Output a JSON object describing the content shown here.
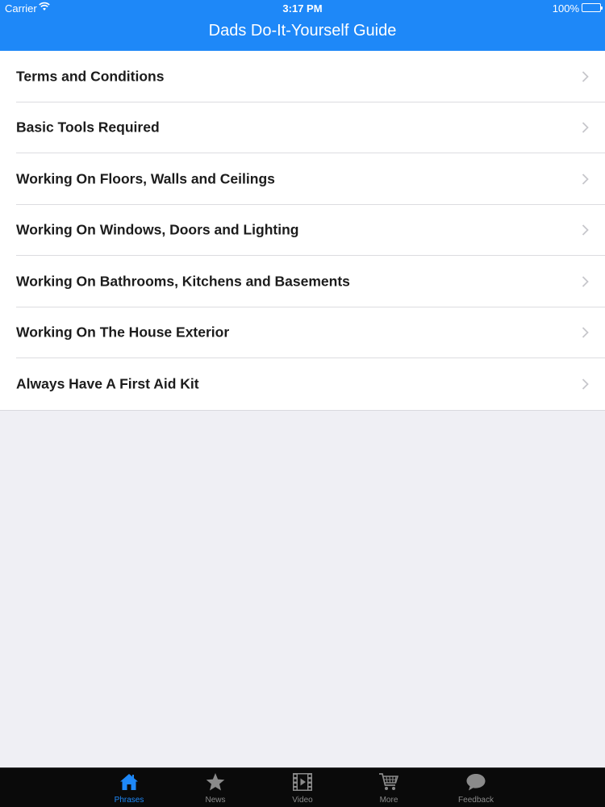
{
  "status_bar": {
    "carrier": "Carrier",
    "time": "3:17 PM",
    "battery": "100%"
  },
  "nav": {
    "title": "Dads Do-It-Yourself Guide"
  },
  "menu": {
    "items": [
      {
        "label": "Terms and Conditions"
      },
      {
        "label": "Basic Tools Required"
      },
      {
        "label": "Working On Floors, Walls and Ceilings"
      },
      {
        "label": "Working On Windows, Doors and Lighting"
      },
      {
        "label": "Working On Bathrooms, Kitchens and Basements"
      },
      {
        "label": "Working On The House Exterior"
      },
      {
        "label": "Always Have A First Aid Kit"
      }
    ]
  },
  "tabs": [
    {
      "label": "Phrases",
      "icon": "home-icon",
      "active": true
    },
    {
      "label": "News",
      "icon": "star-icon",
      "active": false
    },
    {
      "label": "Video",
      "icon": "film-icon",
      "active": false
    },
    {
      "label": "More",
      "icon": "cart-icon",
      "active": false
    },
    {
      "label": "Feedback",
      "icon": "chat-bubble-icon",
      "active": false
    }
  ],
  "colors": {
    "accent": "#1e88f8",
    "tab_inactive": "#8a8a8a",
    "background": "#efeff4"
  }
}
